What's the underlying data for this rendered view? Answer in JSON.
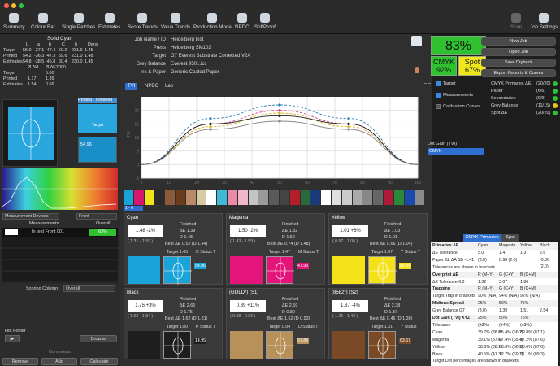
{
  "window": {
    "title": ""
  },
  "toolbar": {
    "items": [
      {
        "label": "Summary",
        "icon": "summary-icon"
      },
      {
        "label": "Colour Bar",
        "icon": "colour-bar-icon"
      },
      {
        "label": "Single Patches",
        "icon": "patches-icon"
      },
      {
        "label": "Estimates",
        "icon": "estimates-icon"
      },
      {
        "label": "Score Trends",
        "icon": "score-trends-icon"
      },
      {
        "label": "Value Trends",
        "icon": "value-trends-icon"
      },
      {
        "label": "Production Mode",
        "icon": "production-icon"
      },
      {
        "label": "NPDC",
        "icon": "npdc-icon"
      },
      {
        "label": "SoftProof",
        "icon": "softproof-icon"
      }
    ],
    "scan": "Scan",
    "job_settings": "Job Settings"
  },
  "left": {
    "title": "Solid Cyan",
    "cols": [
      "L",
      "a",
      "b",
      "C",
      "h",
      "Dens"
    ],
    "rows": [
      {
        "label": "Target",
        "vals": [
          "55.0",
          "-37.1",
          "-47.4",
          "60.2",
          "231.9",
          "1.45"
        ]
      },
      {
        "label": "Printed",
        "vals": [
          "54.2",
          "-36.3",
          "-47.3",
          "59.6",
          "231.0",
          "1.48"
        ]
      },
      {
        "label": "Estimates",
        "vals": [
          "54.8",
          "-38.5",
          "-45.8",
          "60.4",
          "230.0",
          "1.45"
        ]
      }
    ],
    "delta_hdr": [
      "Ø ΔH",
      "Ø ΔE2000"
    ],
    "dens_rows": [
      {
        "label": "Target",
        "v1": "",
        "v2": "5.00"
      },
      {
        "label": "Printed",
        "v1": "1.17",
        "v2": "1.39"
      },
      {
        "label": "Estimates",
        "v1": "1.54",
        "v2": "0.66"
      }
    ],
    "printed_label": "Printed",
    "finished_label": "Finished",
    "target_label": "Target",
    "patch_value": "54.96",
    "meas_devices": "Measurement Devices",
    "front": "Front",
    "meas_hdr": "Measurements",
    "overall_hdr": "Overall",
    "meas_row": "In test Front 001",
    "meas_score": "63%",
    "scoring_label": "Scoring Column",
    "scoring_value": "Overall",
    "hot_folder": "Hot Folder",
    "browse": "Browse",
    "comments": "Comments",
    "remove": "Remove",
    "add": "Add",
    "calculate": "Calculate"
  },
  "job": {
    "rows": [
      {
        "k": "Job Name / ID",
        "v": "Heidelberg test"
      },
      {
        "k": "Press",
        "v": "Heidelberg SM102"
      },
      {
        "k": "Target",
        "v": "G7 Everest Substrate Corrected V2A"
      },
      {
        "k": "Grey Balance",
        "v": "Everest 9501.icc"
      },
      {
        "k": "Ink & Paper",
        "v": "Generic Coated Paper"
      }
    ],
    "score": "83%",
    "cmyk_label": "CMYK",
    "cmyk_val": "92%",
    "spot_label": "Spot",
    "spot_val": "67%"
  },
  "buttons": {
    "new_job": "New Job",
    "open_job": "Open Job",
    "save_dryback": "Save Dryback",
    "export": "Export Reports & Curves"
  },
  "legend": {
    "target": "Target",
    "measurements": "Measurements",
    "calibration": "Calibration Curves"
  },
  "scores": [
    {
      "k": "CMYK Primaries ΔE",
      "v": "(20/20)",
      "c": "#2fc12f"
    },
    {
      "k": "Paper",
      "v": "(6/6)",
      "c": "#2fc12f"
    },
    {
      "k": "Secondaries",
      "v": "(9/9)",
      "c": "#2fc12f"
    },
    {
      "k": "Grey Balance",
      "v": "(11/15)",
      "c": "#e8c21a"
    },
    {
      "k": "Spot ΔE",
      "v": "(20/20)",
      "c": "#2fc12f"
    }
  ],
  "dotgain": {
    "label": "Dot Gain (TVI)",
    "select": "CMYK"
  },
  "chart_tabs": [
    "TVI",
    "NPDC",
    "Lab"
  ],
  "chart_data": {
    "type": "line",
    "x_ticks": [
      "0",
      "10",
      "20",
      "30",
      "40",
      "50",
      "60",
      "70",
      "80",
      "90",
      "100"
    ],
    "y_ticks": [
      "-5",
      "0",
      "5",
      "10",
      "15",
      "20"
    ],
    "ylabel": "TVI",
    "xlim": [
      0,
      100
    ],
    "ylim": [
      -5,
      25
    ],
    "series": [
      {
        "color": "#2a7fb8",
        "dash": true,
        "values": [
          [
            0,
            0
          ],
          [
            25,
            17
          ],
          [
            50,
            22
          ],
          [
            75,
            17
          ],
          [
            100,
            0
          ]
        ]
      },
      {
        "color": "#d63a8a",
        "dash": true,
        "values": [
          [
            0,
            0
          ],
          [
            25,
            15
          ],
          [
            50,
            20
          ],
          [
            75,
            15
          ],
          [
            100,
            0
          ]
        ]
      },
      {
        "color": "#d4b21a",
        "dash": true,
        "values": [
          [
            0,
            0
          ],
          [
            25,
            14
          ],
          [
            50,
            19
          ],
          [
            75,
            14
          ],
          [
            100,
            0
          ]
        ]
      },
      {
        "color": "#222222",
        "dash": false,
        "values": [
          [
            0,
            0
          ],
          [
            25,
            15
          ],
          [
            50,
            18
          ],
          [
            75,
            15
          ],
          [
            100,
            0
          ]
        ]
      },
      {
        "color": "#888888",
        "dash": false,
        "values": [
          [
            0,
            0
          ],
          [
            25,
            13
          ],
          [
            50,
            16
          ],
          [
            75,
            13
          ],
          [
            100,
            0
          ]
        ]
      }
    ]
  },
  "swatch_select": "1 - 6",
  "swatches": [
    "#1aa3d8",
    "#d6156f",
    "#f2e21a",
    "#2a2a2a",
    "#8a5a3a",
    "#6b3b1a",
    "#b88a6a",
    "#d6cba0",
    "#ffffff",
    "#3cbad7",
    "#e88aa8",
    "#f0b5c8",
    "#c4c4c4",
    "#9a9a9a",
    "#5a5a5a",
    "#444444",
    "#b41e2a",
    "#2a6a3a",
    "#1a3a7a",
    "#ffffff",
    "#e0e0e0",
    "#cccccc",
    "#aaaaaa",
    "#888888",
    "#666666",
    "#b01a3a",
    "#2a8a3a",
    "#1a4ab0",
    "#8a8a8a"
  ],
  "cards": [
    {
      "title": "Cyan",
      "range": "1.48 -2%",
      "bracket": "( 1.31 - 1.59 )",
      "finished": "Finished",
      "de": "ΔE 1.39",
      "d": "D 1.48",
      "best": "Best ΔE 0.52 (D 1.44)",
      "target_lbl": "Target 1.45",
      "status": "C Status T",
      "val": "54.96",
      "color": "#1aa3d8"
    },
    {
      "title": "Magenta",
      "range": "1.50 -2%",
      "bracket": "( 1.43 - 1.59 )",
      "finished": "Finished",
      "de": "ΔE 1.32",
      "d": "D 1.50",
      "best": "Best ΔE 0.74 (D 1.48)",
      "target_lbl": "Target 1.47",
      "status": "M Status T",
      "val": "47.93",
      "color": "#e3157a"
    },
    {
      "title": "Yellow",
      "range": "1.01 +6%",
      "bracket": "( 0.97 - 1.06 )",
      "finished": "Finished",
      "de": "ΔE 1.03",
      "d": "D 1.01",
      "best": "Best ΔE 0.66 (D 1.04)",
      "target_lbl": "Target 1.07",
      "status": "Y Status T",
      "val": "88.94",
      "color": "#f5e11a"
    },
    {
      "title": "Black",
      "range": "1.75 +3%",
      "bracket": "( 1.62 - 1.84 )",
      "finished": "Finished",
      "de": "ΔE 2.65",
      "d": "D 1.75",
      "best": "Best ΔE 1.62 (D 1.81)",
      "target_lbl": "Target 1.80",
      "status": "K Status T",
      "val": "14.95",
      "color": "#1e1e1e"
    },
    {
      "title": "(GOLD*) (S1)",
      "range": "0.89 +11%",
      "bracket": "( 0.88 - 0.93 )",
      "finished": "Finished",
      "de": "ΔE 2.59",
      "d": "D 0.89",
      "best": "Best ΔE 1.62 (D 0.93)",
      "target_lbl": "Target 0.94",
      "status": "D Status T",
      "val": "57.84",
      "color": "#b8905a"
    },
    {
      "title": "(8582*) (S2)",
      "range": "1.37 -4%",
      "bracket": "( 1.26 - 1.42 )",
      "finished": "Finished",
      "de": "ΔE 2.38",
      "d": "D 1.37",
      "best": "Best ΔE 0.46 (D 1.30)",
      "target_lbl": "Target 1.31",
      "status": "Y Status T",
      "val": "63.67",
      "color": "#7a4a26"
    }
  ],
  "table": {
    "tabs": [
      "CMYK Primaries",
      "Spot"
    ],
    "rows": [
      {
        "c": [
          "Primaries ΔE",
          "Cyan",
          "Magenta",
          "Yellow",
          "Black"
        ],
        "s": "hdrrow"
      },
      {
        "c": [
          "ΔE Tolerance",
          "5.0",
          "1.4",
          "1.3",
          "2.6"
        ]
      },
      {
        "c": [
          "Paper ΔL ΔA ΔB -1.41",
          "(3.0)",
          "0.98 (2.0)",
          "",
          "-0.86 (2.0)"
        ]
      },
      {
        "c": [
          "Tolerances are shown in brackets",
          "",
          "",
          "",
          ""
        ]
      },
      {
        "c": [
          "Overprint ΔE",
          "R (M+Y)",
          "G (C+Y)",
          "B (C+M)",
          ""
        ],
        "s": "hdrrow"
      },
      {
        "c": [
          "ΔE Tolerance 6.0",
          "1.32",
          "3.07",
          "1.86",
          ""
        ]
      },
      {
        "c": [
          "Trapping",
          "R (M+Y)",
          "G (C+Y)",
          "B (C+M)",
          ""
        ],
        "s": "hdrrow"
      },
      {
        "c": [
          "Target Trap in brackets",
          "90% (N/A)",
          "94% (N/A)",
          "92% (N/A)",
          ""
        ]
      },
      {
        "c": [
          "Midtone Spread",
          "25%",
          "50%",
          "75%",
          ""
        ],
        "s": "hdrrow"
      },
      {
        "c": [
          "Grey Balance G7",
          "(3.0)",
          "1.39",
          "1.51",
          "2.54"
        ]
      },
      {
        "c": [
          "Dot Gain (TVI) XYZ",
          "25%",
          "50%",
          "75%",
          ""
        ],
        "s": "hdrrow"
      },
      {
        "c": [
          "Tolerance",
          "(±3%)",
          "(±4%)",
          "(±3%)",
          ""
        ]
      },
      {
        "c": [
          "Cyan",
          "39.7% (38.0)",
          "65.4% (66.2)",
          "89.8% (87.1)",
          ""
        ]
      },
      {
        "c": [
          "Magenta",
          "39.1% (37.6)",
          "67.4% (65.4)",
          "87.2% (87.6)",
          ""
        ]
      },
      {
        "c": [
          "Yellow",
          "38.6% (38.1)",
          "66.8% (66.5)",
          "86.6% (87.6)",
          ""
        ]
      },
      {
        "c": [
          "Black",
          "40.5% (41.3)",
          "72.7% (69.7)",
          "91.1% (89.3)",
          ""
        ]
      },
      {
        "c": [
          "Target Dot percentages are shown in brackets",
          "",
          "",
          "",
          ""
        ]
      }
    ]
  }
}
